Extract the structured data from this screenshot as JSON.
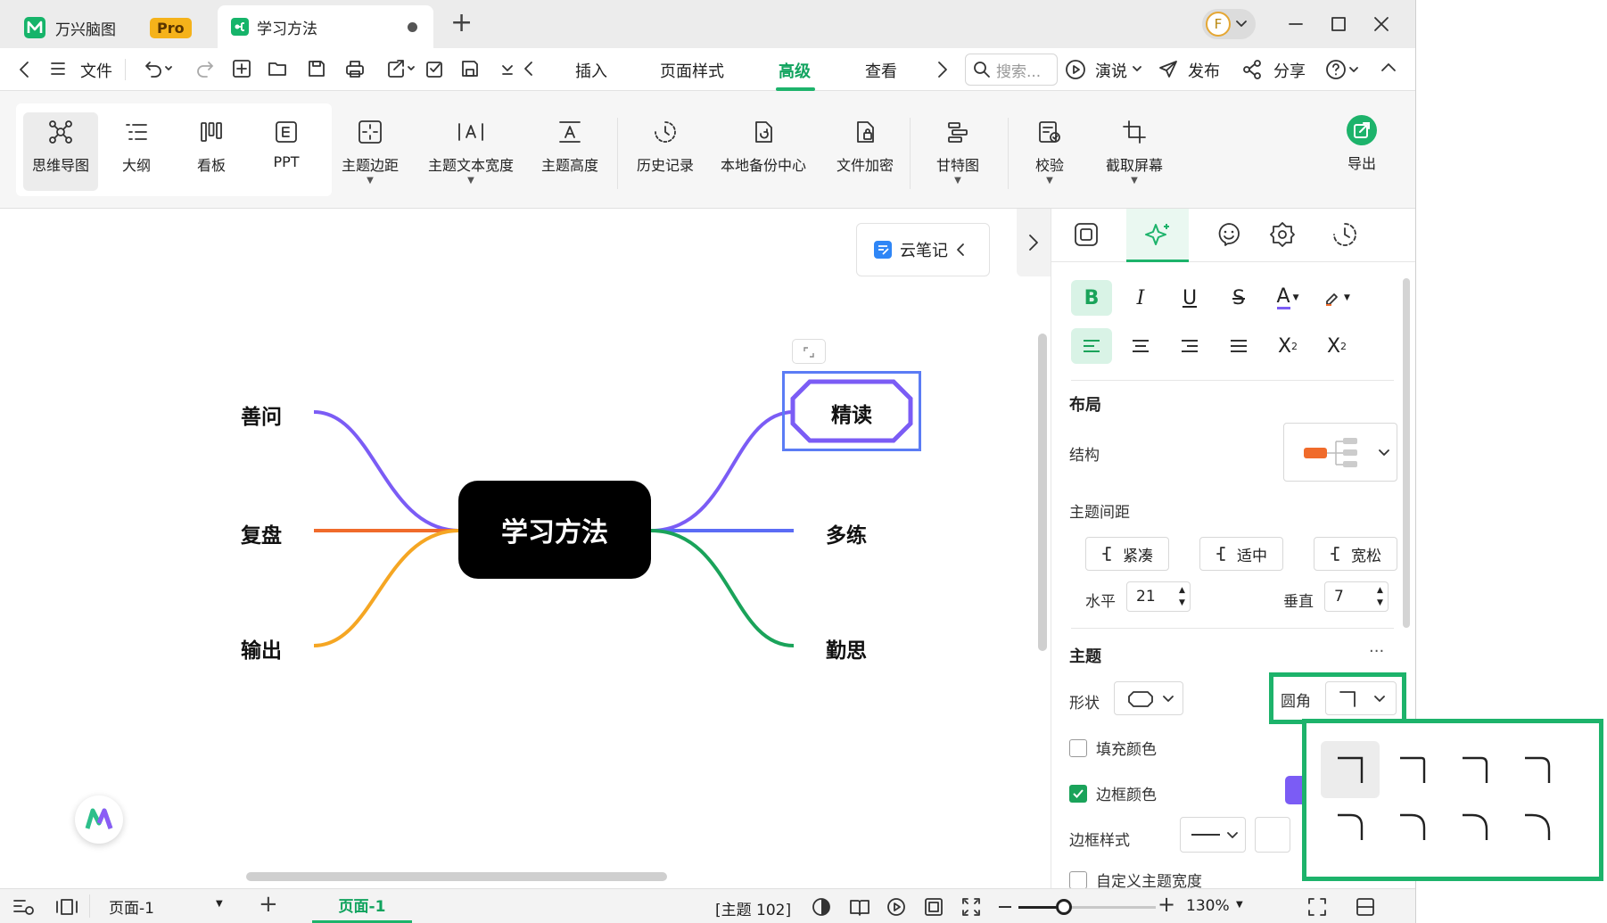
{
  "titlebar": {
    "app_tab": {
      "label": "万兴脑图",
      "badge": "Pro"
    },
    "doc_tab": {
      "label": "学习方法"
    },
    "new_tab": "+",
    "user_initial": "F"
  },
  "menubar": {
    "file": "文件",
    "tabs": [
      "插入",
      "页面样式",
      "高级",
      "查看"
    ],
    "active_tab": "高级",
    "search_placeholder": "搜索...",
    "present": "演说",
    "publish": "发布",
    "share": "分享"
  },
  "ribbon": {
    "views": [
      "思维导图",
      "大纲",
      "看板",
      "PPT"
    ],
    "tools": [
      "主题边距",
      "主题文本宽度",
      "主题高度",
      "历史记录",
      "本地备份中心",
      "文件加密",
      "甘特图",
      "校验",
      "截取屏幕"
    ],
    "export": "导出"
  },
  "canvas": {
    "central": "学习方法",
    "left_nodes": [
      "善问",
      "复盘",
      "输出"
    ],
    "right_nodes": [
      "精读",
      "多练",
      "勤思"
    ],
    "cloud_note": "云笔记"
  },
  "panel": {
    "layout_title": "布局",
    "structure_label": "结构",
    "spacing_label": "主题间距",
    "spacing_options": [
      "紧凑",
      "适中",
      "宽松"
    ],
    "horizontal_label": "水平",
    "horizontal_value": "21",
    "vertical_label": "垂直",
    "vertical_value": "7",
    "topic_title": "主题",
    "more": "···",
    "shape_label": "形状",
    "corner_label": "圆角",
    "fill_label": "填充颜色",
    "border_color_label": "边框颜色",
    "border_style_label": "边框样式",
    "custom_width_label": "自定义主题宽度"
  },
  "statusbar": {
    "page_select": "页面-1",
    "page_tab": "页面-1",
    "topic_count": "[主题 102]",
    "zoom": "130%"
  },
  "colors": {
    "accent": "#1db36b",
    "purple": "#7b5cf5",
    "orange": "#f06b2b",
    "yellow": "#f5a623",
    "blue": "#5b6cf5",
    "green": "#1aa35a",
    "select": "#5b7cf5"
  }
}
